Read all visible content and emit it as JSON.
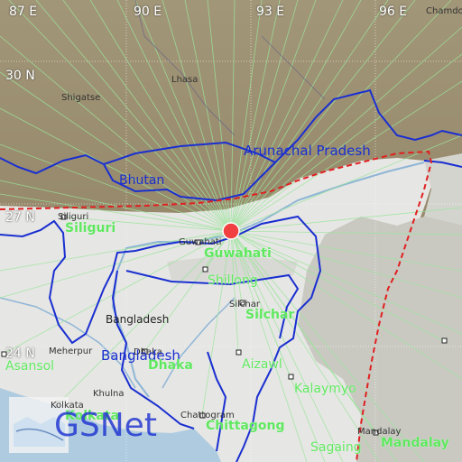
{
  "grid": {
    "lon_labels": [
      "87 E",
      "90 E",
      "93 E",
      "96 E"
    ],
    "lat_labels": [
      "30 N",
      "27 N",
      "24 N"
    ]
  },
  "regions": {
    "arunachal": "Arunachal Pradesh",
    "bhutan": "Bhutan",
    "bangladesh_blue": "Bangladesh"
  },
  "stations": {
    "siliguri": "Siliguri",
    "guwahati": "Guwahati",
    "silchar": "Silchar",
    "asansol": "Asansol",
    "dhaka": "Dhaka",
    "aizawl": "Aizawl",
    "kalaymyo": "Kalaymyo",
    "kolkata": "Kolkata",
    "chittagong": "Chittagong",
    "sagaing": "Sagaing",
    "mandalay": "Mandalay",
    "shillong": "Shillong"
  },
  "basemap": {
    "siliguri": "Siliguri",
    "guwahati": "Guwahati",
    "silchar": "Silchar",
    "bangladesh": "Bangladesh",
    "meherpur": "Meherpur",
    "dhaka": "Dhaka",
    "khulna": "Khulna",
    "chittagong": "Chattogram",
    "mandalay": "Mandalay",
    "lhasa": "Lhasa",
    "shigatse": "Shigatse",
    "kolkata": "Kolkata",
    "chamdo": "Chamdo"
  },
  "logo": "GSNet",
  "colors": {
    "terrain": "#9c8f72",
    "lowland": "#e8e8e6",
    "border_blue": "#1a2fd0",
    "fault_red": "#e02020",
    "ray_green": "#8fe88f",
    "epicenter": "#f04040"
  }
}
